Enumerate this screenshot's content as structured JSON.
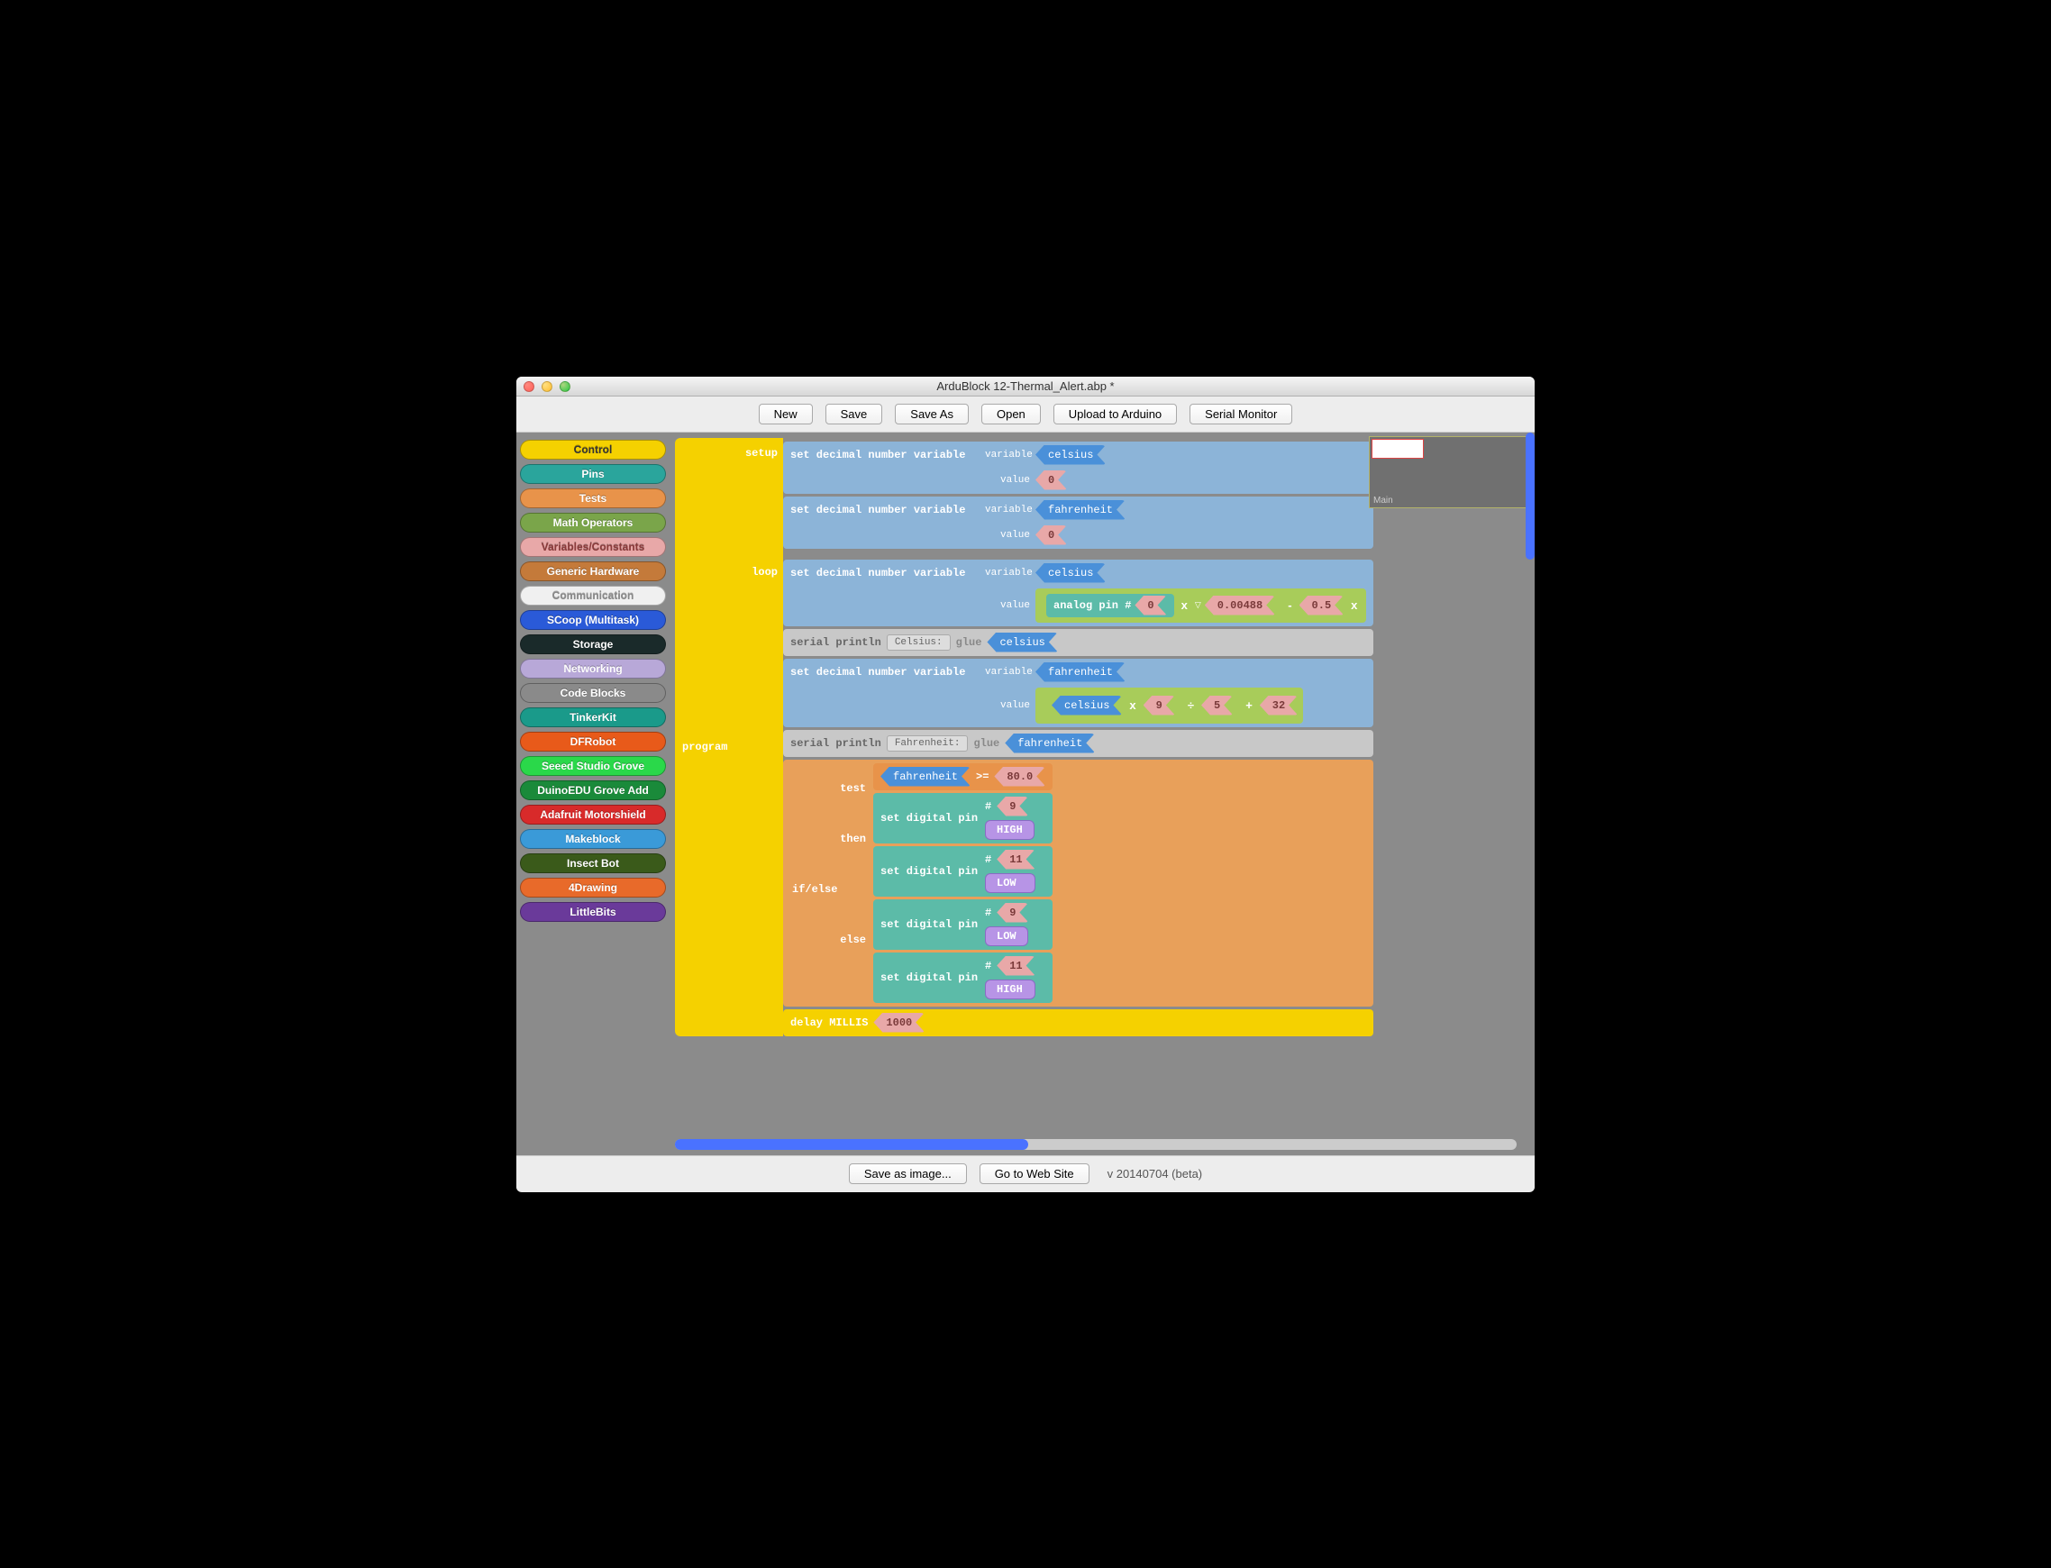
{
  "window": {
    "title": "ArduBlock 12-Thermal_Alert.abp *"
  },
  "toolbar": {
    "new": "New",
    "save": "Save",
    "saveas": "Save As",
    "open": "Open",
    "upload": "Upload to Arduino",
    "serial": "Serial Monitor"
  },
  "categories": [
    {
      "label": "Control",
      "bg": "#f5d100",
      "fg": "#333"
    },
    {
      "label": "Pins",
      "bg": "#2aa59c",
      "fg": "#fff"
    },
    {
      "label": "Tests",
      "bg": "#e8934a",
      "fg": "#fff"
    },
    {
      "label": "Math Operators",
      "bg": "#7aa54a",
      "fg": "#fff"
    },
    {
      "label": "Variables/Constants",
      "bg": "#e8a8a8",
      "fg": "#8a3a3a"
    },
    {
      "label": "Generic Hardware",
      "bg": "#c47a3a",
      "fg": "#fff"
    },
    {
      "label": "Communication",
      "bg": "#f0f0f0",
      "fg": "#888"
    },
    {
      "label": "SCoop (Multitask)",
      "bg": "#2a5ad8",
      "fg": "#fff"
    },
    {
      "label": "Storage",
      "bg": "#1a2a2a",
      "fg": "#fff"
    },
    {
      "label": "Networking",
      "bg": "#b8a8d8",
      "fg": "#fff"
    },
    {
      "label": "Code Blocks",
      "bg": "#8a8a8a",
      "fg": "#fff"
    },
    {
      "label": "TinkerKit",
      "bg": "#1a9a8a",
      "fg": "#fff"
    },
    {
      "label": "DFRobot",
      "bg": "#e85a1a",
      "fg": "#fff"
    },
    {
      "label": "Seeed Studio Grove",
      "bg": "#2ad84a",
      "fg": "#fff"
    },
    {
      "label": "DuinoEDU Grove Add",
      "bg": "#1a8a3a",
      "fg": "#fff"
    },
    {
      "label": "Adafruit Motorshield",
      "bg": "#d82a2a",
      "fg": "#fff"
    },
    {
      "label": "Makeblock",
      "bg": "#3a9ad8",
      "fg": "#fff"
    },
    {
      "label": "Insect Bot",
      "bg": "#3a5a1a",
      "fg": "#fff"
    },
    {
      "label": "4Drawing",
      "bg": "#e86a2a",
      "fg": "#fff"
    },
    {
      "label": "LittleBits",
      "bg": "#6a3a9a",
      "fg": "#fff"
    }
  ],
  "program": {
    "label": "program",
    "setup_label": "setup",
    "loop_label": "loop",
    "setvar": "set decimal number variable",
    "variable_lbl": "variable",
    "value_lbl": "value",
    "celsius": "celsius",
    "fahrenheit": "fahrenheit",
    "zero": "0",
    "serial_println": "serial println",
    "celsius_colon": "Celsius:",
    "fahrenheit_colon": "Fahrenheit:",
    "glue": "glue",
    "analog_pin": "analog pin #",
    "pin0": "0",
    "mult1": "0.00488",
    "minus": "-",
    "half": "0.5",
    "x_sym": "x",
    "times": "×",
    "plus": "+",
    "div": "÷",
    "nine": "9",
    "five": "5",
    "thirtytwo": "32",
    "ifelse": "if/else",
    "test": "test",
    "then": "then",
    "else": "else",
    "gte": ">=",
    "eighty": "80.0",
    "set_digital": "set digital pin",
    "hash": "#",
    "pin9": "9",
    "pin11": "11",
    "HIGH": "HIGH",
    "LOW": "LOW",
    "delay": "delay MILLIS",
    "ms": "1000"
  },
  "minimap": {
    "label": "Main"
  },
  "bottom": {
    "saveimg": "Save as image...",
    "gotoweb": "Go to Web Site",
    "version": "v 20140704 (beta)"
  }
}
